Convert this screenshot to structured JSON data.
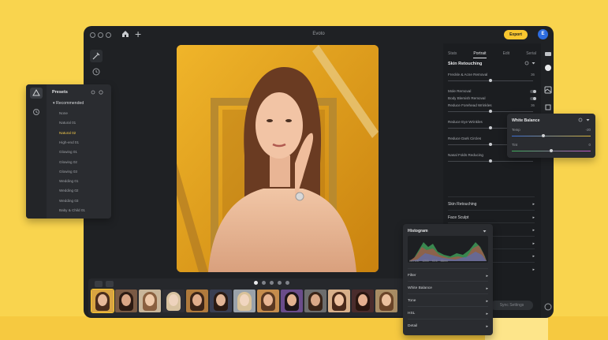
{
  "app": {
    "title": "Evoto",
    "export_label": "Export",
    "avatar_initial": "E",
    "accent_color": "#f8c62f",
    "background_color": "#f9d44e"
  },
  "right_panel": {
    "tabs": [
      "Stats",
      "Portrait",
      "Edit",
      "Serial"
    ],
    "active_tab": "Portrait",
    "section_title": "Skin Retouching",
    "adjustments": [
      {
        "label": "Freckle & Acne Removal",
        "value": "36",
        "level": 0.5
      },
      {
        "label": "Mole Removal",
        "toggle": true
      },
      {
        "label": "Body Blemish Removal",
        "toggle": true
      },
      {
        "label": "Reduce Forehead Wrinkles",
        "value": "36",
        "level": 0.5
      },
      {
        "label": "Reduce Eye Wrinkles",
        "value": "36",
        "level": 0.5
      },
      {
        "label": "Reduce Dark Circles",
        "value": "36",
        "level": 0.5
      },
      {
        "label": "Nasal Folds Reducing",
        "value": "",
        "level": 0.5
      }
    ],
    "sections": [
      "Skin Retouching",
      "Face Sculpt",
      "Teeth",
      "Eyes",
      "",
      ""
    ],
    "sync_label": "Sync Settings"
  },
  "presets": {
    "title": "Presets",
    "group": "Recommended",
    "items": [
      "None",
      "Natural 01",
      "Natural 02",
      "High-end 01",
      "Glowing 01",
      "Glowing 02",
      "Glowing 03",
      "Wedding 01",
      "Wedding 02",
      "Wedding 03",
      "Baby & Child 01"
    ],
    "active_item": "Natural 02"
  },
  "white_balance": {
    "title": "White Balance",
    "temp_label": "Temp",
    "temp_value": "-20",
    "temp_level": 0.4,
    "tint_label": "Tint",
    "tint_value": "0",
    "tint_level": 0.5
  },
  "histogram_panel": {
    "title": "Histogram",
    "stats": [
      "ISO 100",
      "1/200",
      "f/2.8",
      "85mm"
    ],
    "items": [
      "Filter",
      "White Balance",
      "Tone",
      "HSL",
      "Detail"
    ]
  },
  "filmstrip": {
    "page_dots": 5,
    "active_dot": 0,
    "thumb_count": 13
  }
}
